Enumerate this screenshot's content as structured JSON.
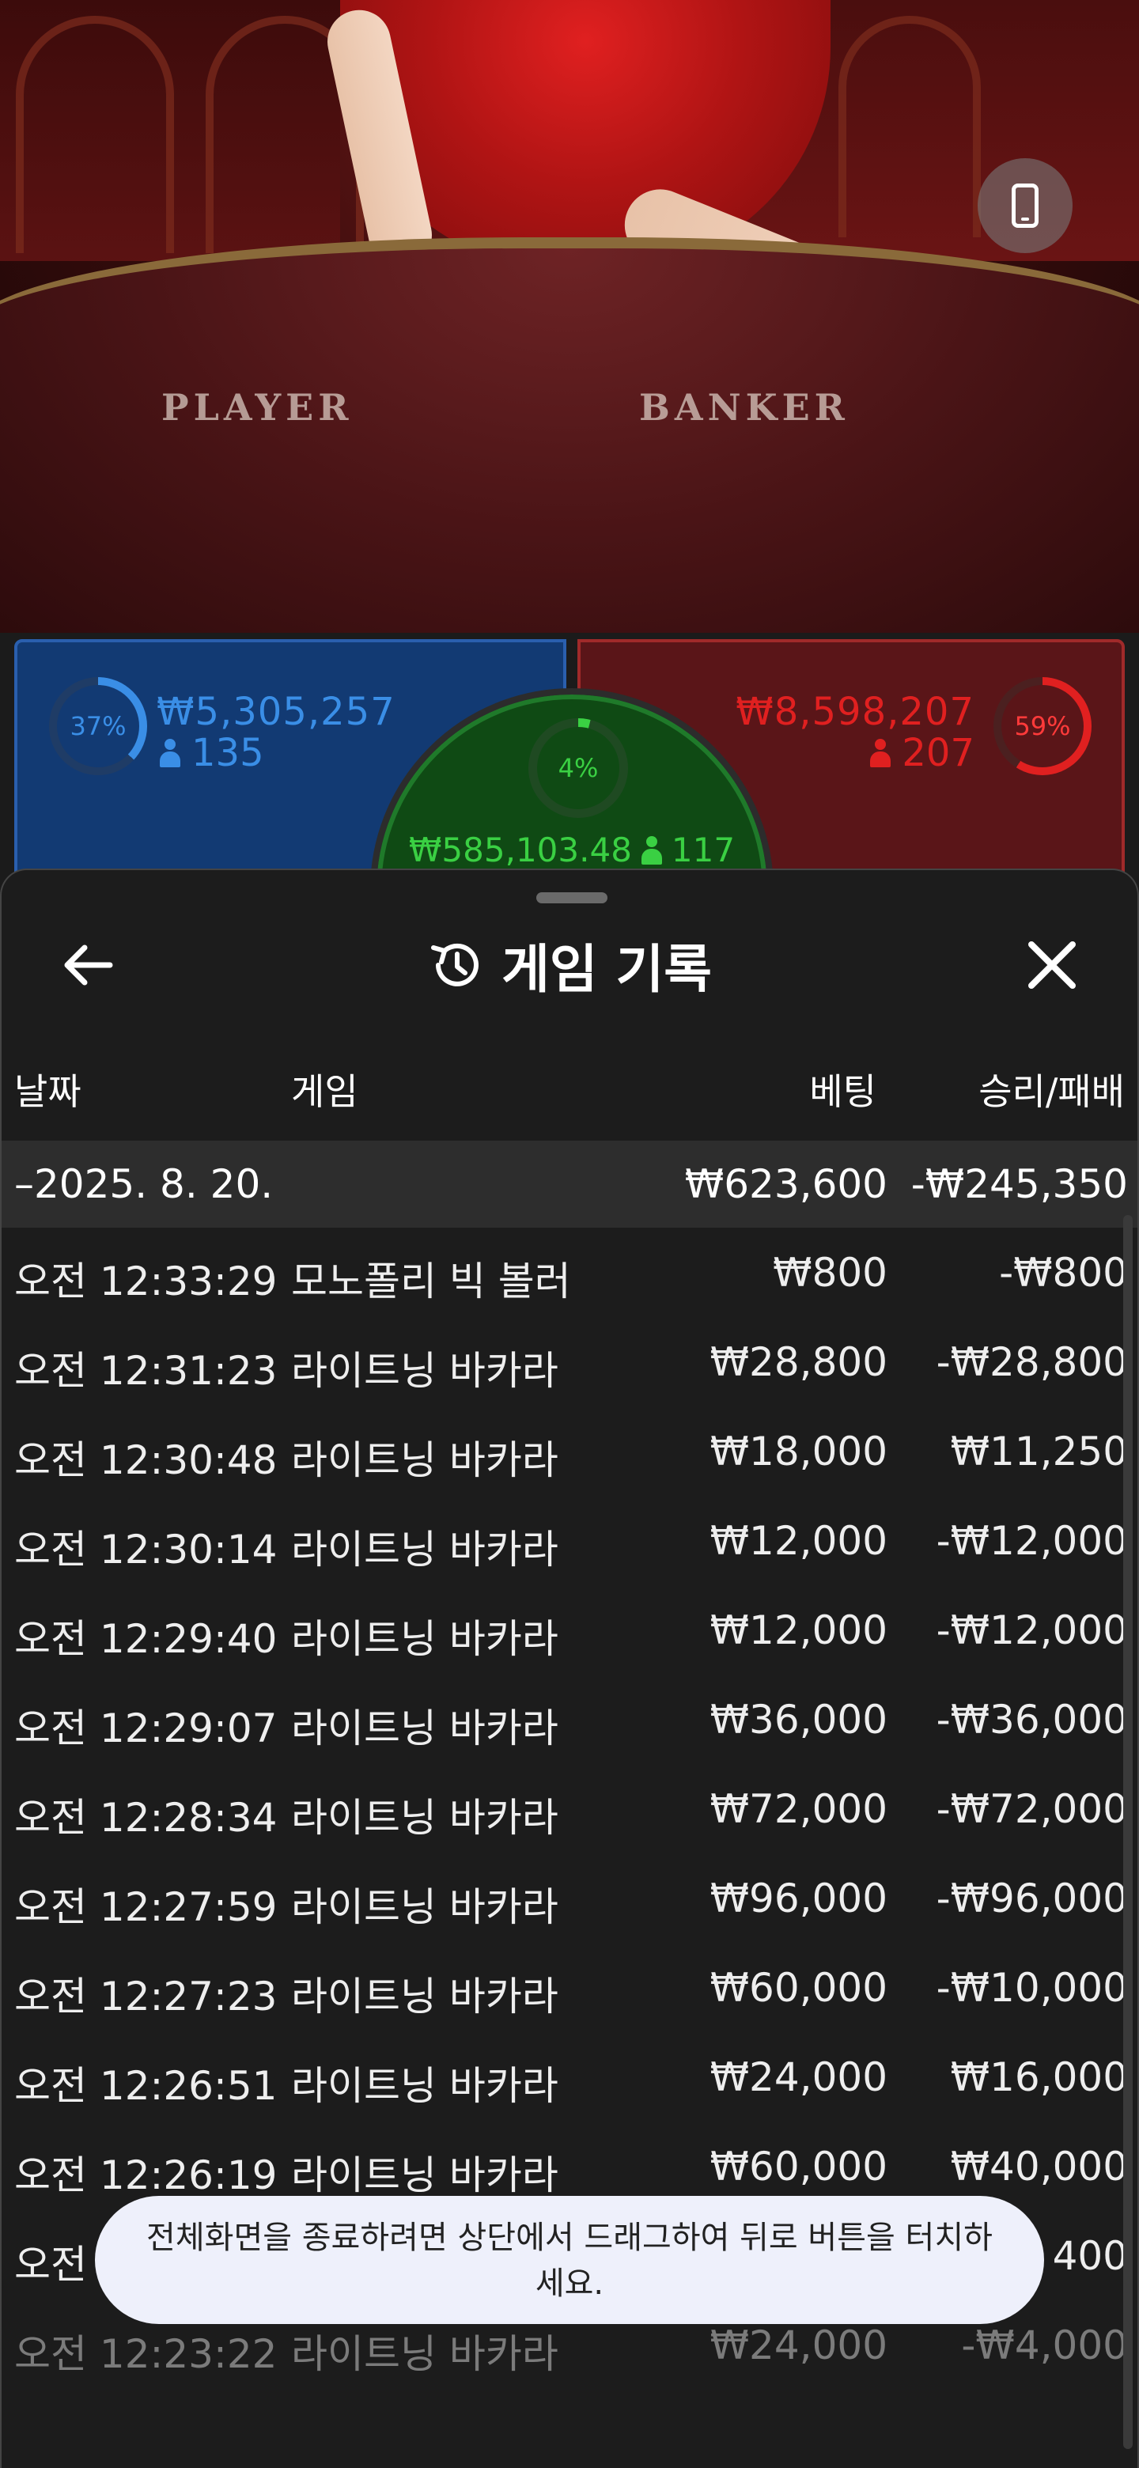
{
  "video": {
    "player_label": "PLAYER",
    "banker_label": "BANKER",
    "rotate_icon": "phone-rotate-icon"
  },
  "bets": {
    "player": {
      "percent": "37%",
      "percent_value": 37,
      "amount": "₩5,305,257",
      "count": "135",
      "color": "#3a8ee6"
    },
    "banker": {
      "percent": "59%",
      "percent_value": 59,
      "amount": "₩8,598,207",
      "count": "207",
      "color": "#e02020"
    },
    "tie": {
      "percent": "4%",
      "percent_value": 4,
      "amount": "₩585,103.48",
      "count": "117",
      "color": "#3ad043"
    }
  },
  "history": {
    "title": "게임 기록",
    "headers": {
      "date": "날짜",
      "game": "게임",
      "bet": "베팅",
      "win_loss": "승리/패배"
    },
    "date_group": {
      "label": "–2025. 8. 20.",
      "bet": "₩623,600",
      "win_loss": "-₩245,350"
    },
    "rows": [
      {
        "time": "오전 12:33:29",
        "game": "모노폴리 빅 볼러",
        "bet": "₩800",
        "win_loss": "-₩800"
      },
      {
        "time": "오전 12:31:23",
        "game": "라이트닝 바카라",
        "bet": "₩28,800",
        "win_loss": "-₩28,800"
      },
      {
        "time": "오전 12:30:48",
        "game": "라이트닝 바카라",
        "bet": "₩18,000",
        "win_loss": "₩11,250"
      },
      {
        "time": "오전 12:30:14",
        "game": "라이트닝 바카라",
        "bet": "₩12,000",
        "win_loss": "-₩12,000"
      },
      {
        "time": "오전 12:29:40",
        "game": "라이트닝 바카라",
        "bet": "₩12,000",
        "win_loss": "-₩12,000"
      },
      {
        "time": "오전 12:29:07",
        "game": "라이트닝 바카라",
        "bet": "₩36,000",
        "win_loss": "-₩36,000"
      },
      {
        "time": "오전 12:28:34",
        "game": "라이트닝 바카라",
        "bet": "₩72,000",
        "win_loss": "-₩72,000"
      },
      {
        "time": "오전 12:27:59",
        "game": "라이트닝 바카라",
        "bet": "₩96,000",
        "win_loss": "-₩96,000"
      },
      {
        "time": "오전 12:27:23",
        "game": "라이트닝 바카라",
        "bet": "₩60,000",
        "win_loss": "-₩10,000"
      },
      {
        "time": "오전 12:26:51",
        "game": "라이트닝 바카라",
        "bet": "₩24,000",
        "win_loss": "₩16,000"
      },
      {
        "time": "오전 12:26:19",
        "game": "라이트닝 바카라",
        "bet": "₩60,000",
        "win_loss": "₩40,000"
      },
      {
        "time": "오전",
        "game": "",
        "bet": "",
        "win_loss": "400"
      },
      {
        "time": "오전 12:23:22",
        "game": "라이트닝 바카라",
        "bet": "₩24,000",
        "win_loss": "-₩4,000"
      }
    ]
  },
  "toast": {
    "text": "전체화면을 종료하려면 상단에서 드래그하여 뒤로 버튼을 터치하세요."
  }
}
